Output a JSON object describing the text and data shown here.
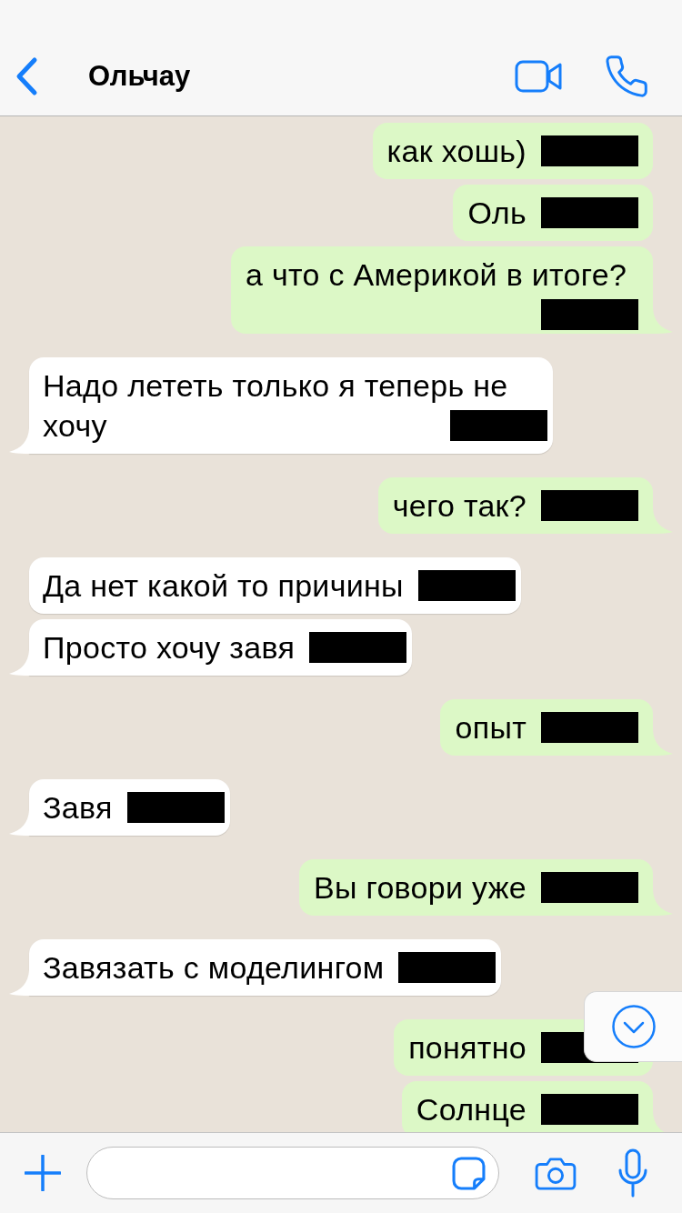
{
  "header": {
    "title": "Ольчау"
  },
  "messages": [
    {
      "kind": "outgoing",
      "text": "как хошь)",
      "redacted": true
    },
    {
      "kind": "outgoing",
      "text": "Оль",
      "redacted": true
    },
    {
      "kind": "outgoing",
      "text": "а что с Америкой в итоге?",
      "redacted": true
    },
    {
      "kind": "incoming",
      "text": "Надо лететь только я теперь не хочу",
      "redacted": true
    },
    {
      "kind": "outgoing",
      "text": "чего так?",
      "redacted": true
    },
    {
      "kind": "incoming",
      "text": "Да нет какой то причины",
      "redacted": true
    },
    {
      "kind": "incoming",
      "text": "Просто хочу завя",
      "redacted": true
    },
    {
      "kind": "outgoing",
      "text": "опыт",
      "redacted": true
    },
    {
      "kind": "incoming",
      "text": "Завя",
      "redacted": true
    },
    {
      "kind": "outgoing",
      "text": "Вы говори уже",
      "redacted": true
    },
    {
      "kind": "incoming",
      "text": "Завязать с моделингом",
      "redacted": true
    },
    {
      "kind": "outgoing",
      "text": "понятно",
      "redacted": true
    },
    {
      "kind": "outgoing",
      "text": "Солнце",
      "redacted": true
    }
  ]
}
